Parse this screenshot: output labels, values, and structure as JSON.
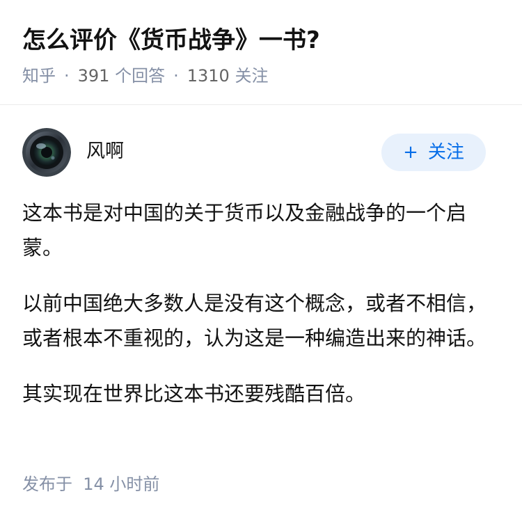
{
  "question": {
    "title": "怎么评价《货币战争》一书?",
    "source": "知乎",
    "answer_count": "391",
    "answer_label": "个回答",
    "follower_count": "1310",
    "follower_label": "关注",
    "separator": "·"
  },
  "author": {
    "name": "风啊",
    "follow_icon": "+",
    "follow_label": "关注"
  },
  "answer": {
    "paragraphs": [
      "这本书是对中国的关于货币以及金融战争的一个启蒙。",
      "以前中国绝大多数人是没有这个概念，或者不相信，或者根本不重视的，认为这是一种编造出来的神话。",
      "其实现在世界比这本书还要残酷百倍。"
    ],
    "published_label": "发布于",
    "published_time": "14 小时前"
  },
  "colors": {
    "meta": "#8590a6",
    "accent": "#056de8",
    "follow_bg": "#e8f1fc"
  }
}
